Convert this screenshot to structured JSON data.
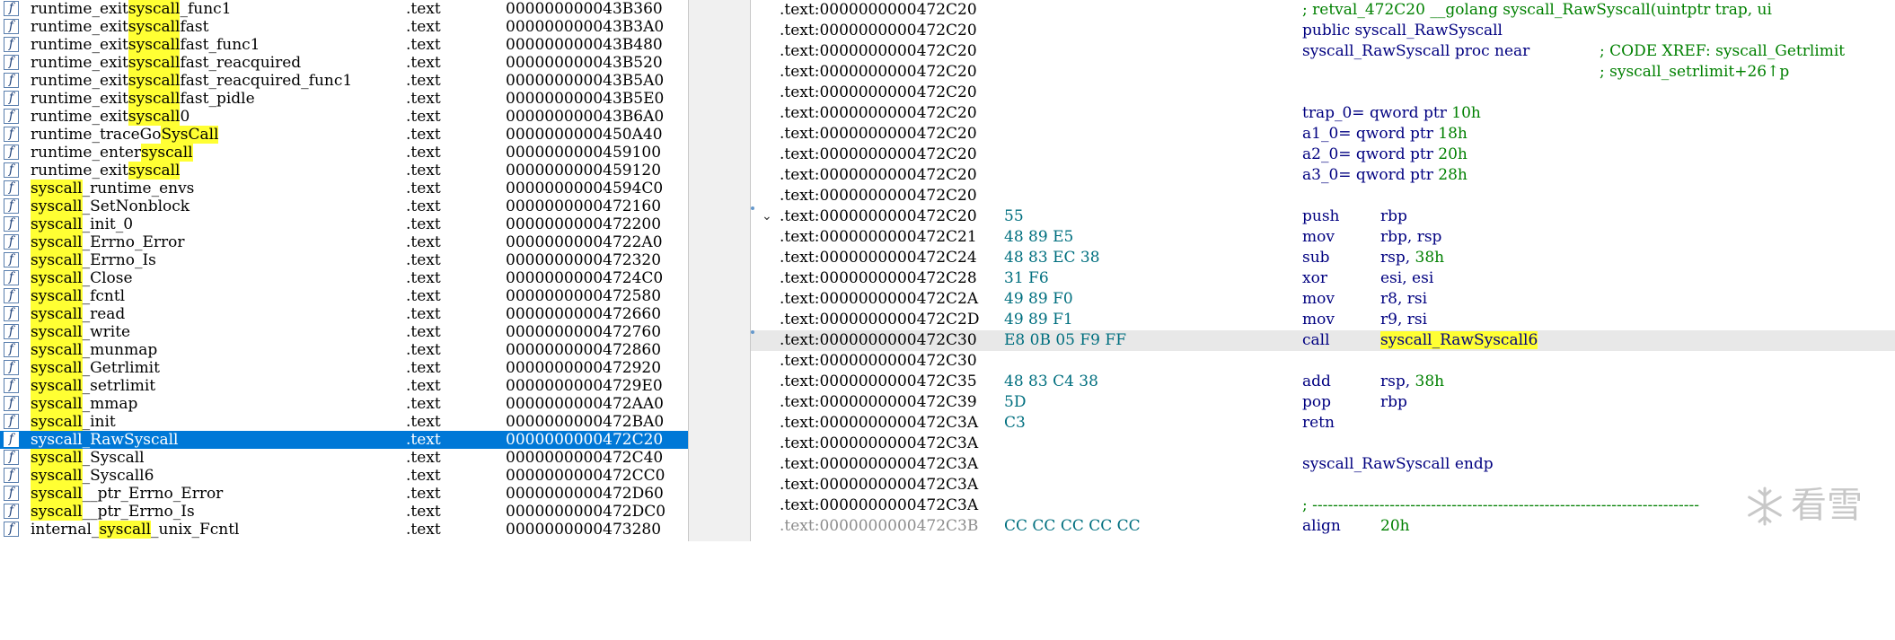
{
  "functions": [
    {
      "name_parts": [
        "runtime_exit",
        "syscall",
        "_func1"
      ],
      "segment": ".text",
      "address": "000000000043B360"
    },
    {
      "name_parts": [
        "runtime_exit",
        "syscall",
        "fast"
      ],
      "segment": ".text",
      "address": "000000000043B3A0"
    },
    {
      "name_parts": [
        "runtime_exit",
        "syscall",
        "fast_func1"
      ],
      "segment": ".text",
      "address": "000000000043B480"
    },
    {
      "name_parts": [
        "runtime_exit",
        "syscall",
        "fast_reacquired"
      ],
      "segment": ".text",
      "address": "000000000043B520"
    },
    {
      "name_parts": [
        "runtime_exit",
        "syscall",
        "fast_reacquired_func1"
      ],
      "segment": ".text",
      "address": "000000000043B5A0"
    },
    {
      "name_parts": [
        "runtime_exit",
        "syscall",
        "fast_pidle"
      ],
      "segment": ".text",
      "address": "000000000043B5E0"
    },
    {
      "name_parts": [
        "runtime_exit",
        "syscall",
        "0"
      ],
      "segment": ".text",
      "address": "000000000043B6A0"
    },
    {
      "name_parts": [
        "runtime_traceGo",
        "SysCall",
        ""
      ],
      "segment": ".text",
      "address": "0000000000450A40"
    },
    {
      "name_parts": [
        "runtime_enter",
        "syscall",
        ""
      ],
      "segment": ".text",
      "address": "0000000000459100"
    },
    {
      "name_parts": [
        "runtime_exit",
        "syscall",
        ""
      ],
      "segment": ".text",
      "address": "0000000000459120"
    },
    {
      "name_parts": [
        "",
        "syscall",
        "_runtime_envs"
      ],
      "segment": ".text",
      "address": "00000000004594C0"
    },
    {
      "name_parts": [
        "",
        "syscall",
        "_SetNonblock"
      ],
      "segment": ".text",
      "address": "0000000000472160"
    },
    {
      "name_parts": [
        "",
        "syscall",
        "_init_0"
      ],
      "segment": ".text",
      "address": "0000000000472200"
    },
    {
      "name_parts": [
        "",
        "syscall",
        "_Errno_Error"
      ],
      "segment": ".text",
      "address": "00000000004722A0"
    },
    {
      "name_parts": [
        "",
        "syscall",
        "_Errno_Is"
      ],
      "segment": ".text",
      "address": "0000000000472320"
    },
    {
      "name_parts": [
        "",
        "syscall",
        "_Close"
      ],
      "segment": ".text",
      "address": "00000000004724C0"
    },
    {
      "name_parts": [
        "",
        "syscall",
        "_fcntl"
      ],
      "segment": ".text",
      "address": "0000000000472580"
    },
    {
      "name_parts": [
        "",
        "syscall",
        "_read"
      ],
      "segment": ".text",
      "address": "0000000000472660"
    },
    {
      "name_parts": [
        "",
        "syscall",
        "_write"
      ],
      "segment": ".text",
      "address": "0000000000472760"
    },
    {
      "name_parts": [
        "",
        "syscall",
        "_munmap"
      ],
      "segment": ".text",
      "address": "0000000000472860"
    },
    {
      "name_parts": [
        "",
        "syscall",
        "_Getrlimit"
      ],
      "segment": ".text",
      "address": "0000000000472920"
    },
    {
      "name_parts": [
        "",
        "syscall",
        "_setrlimit"
      ],
      "segment": ".text",
      "address": "00000000004729E0"
    },
    {
      "name_parts": [
        "",
        "syscall",
        "_mmap"
      ],
      "segment": ".text",
      "address": "0000000000472AA0"
    },
    {
      "name_parts": [
        "",
        "syscall",
        "_init"
      ],
      "segment": ".text",
      "address": "0000000000472BA0"
    },
    {
      "name_parts": [
        "",
        "syscall",
        "_RawSyscall"
      ],
      "segment": ".text",
      "address": "0000000000472C20",
      "selected": true
    },
    {
      "name_parts": [
        "",
        "syscall",
        "_Syscall"
      ],
      "segment": ".text",
      "address": "0000000000472C40"
    },
    {
      "name_parts": [
        "",
        "syscall",
        "_Syscall6"
      ],
      "segment": ".text",
      "address": "0000000000472CC0"
    },
    {
      "name_parts": [
        "",
        "syscall",
        "__ptr_Errno_Error"
      ],
      "segment": ".text",
      "address": "0000000000472D60"
    },
    {
      "name_parts": [
        "",
        "syscall",
        "__ptr_Errno_Is"
      ],
      "segment": ".text",
      "address": "0000000000472DC0"
    },
    {
      "name_parts": [
        "internal_",
        "syscall",
        "_unix_Fcntl"
      ],
      "segment": ".text",
      "address": "0000000000473280"
    }
  ],
  "disasm": [
    {
      "addr": ".text:0000000000472C20",
      "bytes": "",
      "kind": "comment",
      "text": "; retval_472C20 __golang syscall_RawSyscall(uintptr trap, ui"
    },
    {
      "addr": ".text:0000000000472C20",
      "bytes": "",
      "kind": "text",
      "text": "public syscall_RawSyscall"
    },
    {
      "addr": ".text:0000000000472C20",
      "bytes": "",
      "kind": "proc",
      "text": "syscall_RawSyscall proc near",
      "comment": "; CODE XREF: syscall_Getrlimit"
    },
    {
      "addr": ".text:0000000000472C20",
      "bytes": "",
      "kind": "xref",
      "comment": "; syscall_setrlimit+26↑p"
    },
    {
      "addr": ".text:0000000000472C20",
      "bytes": "",
      "kind": "blank"
    },
    {
      "addr": ".text:0000000000472C20",
      "bytes": "",
      "kind": "var",
      "text": "trap_0= qword ptr ",
      "num": "10h"
    },
    {
      "addr": ".text:0000000000472C20",
      "bytes": "",
      "kind": "var",
      "text": "a1_0= qword ptr ",
      "num": "18h"
    },
    {
      "addr": ".text:0000000000472C20",
      "bytes": "",
      "kind": "var",
      "text": "a2_0= qword ptr ",
      "num": "20h"
    },
    {
      "addr": ".text:0000000000472C20",
      "bytes": "",
      "kind": "var",
      "text": "a3_0= qword ptr ",
      "num": "28h"
    },
    {
      "addr": ".text:0000000000472C20",
      "bytes": "",
      "kind": "blank"
    },
    {
      "addr": ".text:0000000000472C20",
      "bytes": "55",
      "kind": "ins",
      "mn": "push",
      "op": "rbp",
      "dot": true,
      "collapse": true
    },
    {
      "addr": ".text:0000000000472C21",
      "bytes": "48 89 E5",
      "kind": "ins",
      "mn": "mov",
      "op": "rbp, rsp"
    },
    {
      "addr": ".text:0000000000472C24",
      "bytes": "48 83 EC 38",
      "kind": "ins",
      "mn": "sub",
      "op": "rsp, ",
      "num": "38h"
    },
    {
      "addr": ".text:0000000000472C28",
      "bytes": "31 F6",
      "kind": "ins",
      "mn": "xor",
      "op": "esi, esi"
    },
    {
      "addr": ".text:0000000000472C2A",
      "bytes": "49 89 F0",
      "kind": "ins",
      "mn": "mov",
      "op": "r8, rsi"
    },
    {
      "addr": ".text:0000000000472C2D",
      "bytes": "49 89 F1",
      "kind": "ins",
      "mn": "mov",
      "op": "r9, rsi"
    },
    {
      "addr": ".text:0000000000472C30",
      "bytes": "E8 0B 05 F9 FF",
      "kind": "ins",
      "mn": "call",
      "op": "syscall_RawSyscall6",
      "current": true,
      "dot": true,
      "callhl": true
    },
    {
      "addr": ".text:0000000000472C30",
      "bytes": "",
      "kind": "blank"
    },
    {
      "addr": ".text:0000000000472C35",
      "bytes": "48 83 C4 38",
      "kind": "ins",
      "mn": "add",
      "op": "rsp, ",
      "num": "38h"
    },
    {
      "addr": ".text:0000000000472C39",
      "bytes": "5D",
      "kind": "ins",
      "mn": "pop",
      "op": "rbp"
    },
    {
      "addr": ".text:0000000000472C3A",
      "bytes": "C3",
      "kind": "ins",
      "mn": "retn",
      "op": ""
    },
    {
      "addr": ".text:0000000000472C3A",
      "bytes": "",
      "kind": "blank"
    },
    {
      "addr": ".text:0000000000472C3A",
      "bytes": "",
      "kind": "text",
      "text": "syscall_RawSyscall endp"
    },
    {
      "addr": ".text:0000000000472C3A",
      "bytes": "",
      "kind": "blank"
    },
    {
      "addr": ".text:0000000000472C3A",
      "bytes": "",
      "kind": "comment",
      "text": "; ---------------------------------------------------------------------------"
    },
    {
      "addr": ".text:0000000000472C3B",
      "bytes": "CC CC CC CC CC",
      "kind": "ins",
      "mn": "align",
      "op": "",
      "num": "20h",
      "faded": true
    }
  ],
  "watermark": {
    "text": "看雪",
    "icon": "snowflake-icon"
  },
  "colors": {
    "selection": "#0078d7",
    "highlight": "#ffff33",
    "mnemonic": "#000080",
    "comment": "#008000",
    "bytes": "#006f7f"
  }
}
